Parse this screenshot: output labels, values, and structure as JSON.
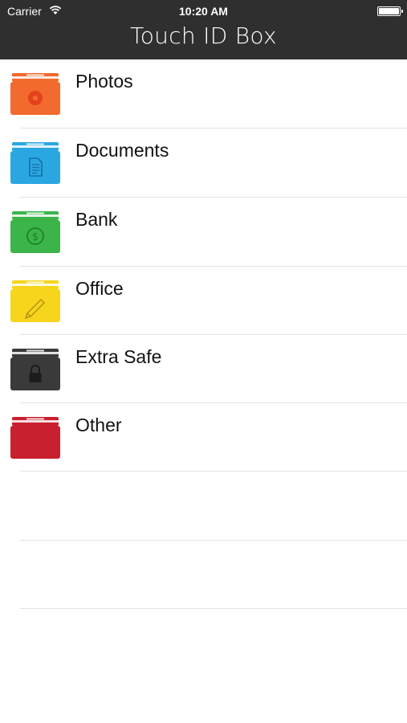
{
  "status_bar": {
    "carrier": "Carrier",
    "time": "10:20 AM"
  },
  "nav": {
    "title": "Touch ID Box"
  },
  "boxes": [
    {
      "label": "Photos",
      "color": "#f26a2e",
      "emblem": "photo-disc-icon"
    },
    {
      "label": "Documents",
      "color": "#2aa7e0",
      "emblem": "document-icon"
    },
    {
      "label": "Bank",
      "color": "#3bb54a",
      "emblem": "dollar-icon"
    },
    {
      "label": "Office",
      "color": "#f7d51d",
      "emblem": "pen-icon"
    },
    {
      "label": "Extra Safe",
      "color": "#3a3a3a",
      "emblem": "lock-icon"
    },
    {
      "label": "Other",
      "color": "#c8202f",
      "emblem": "none"
    }
  ]
}
